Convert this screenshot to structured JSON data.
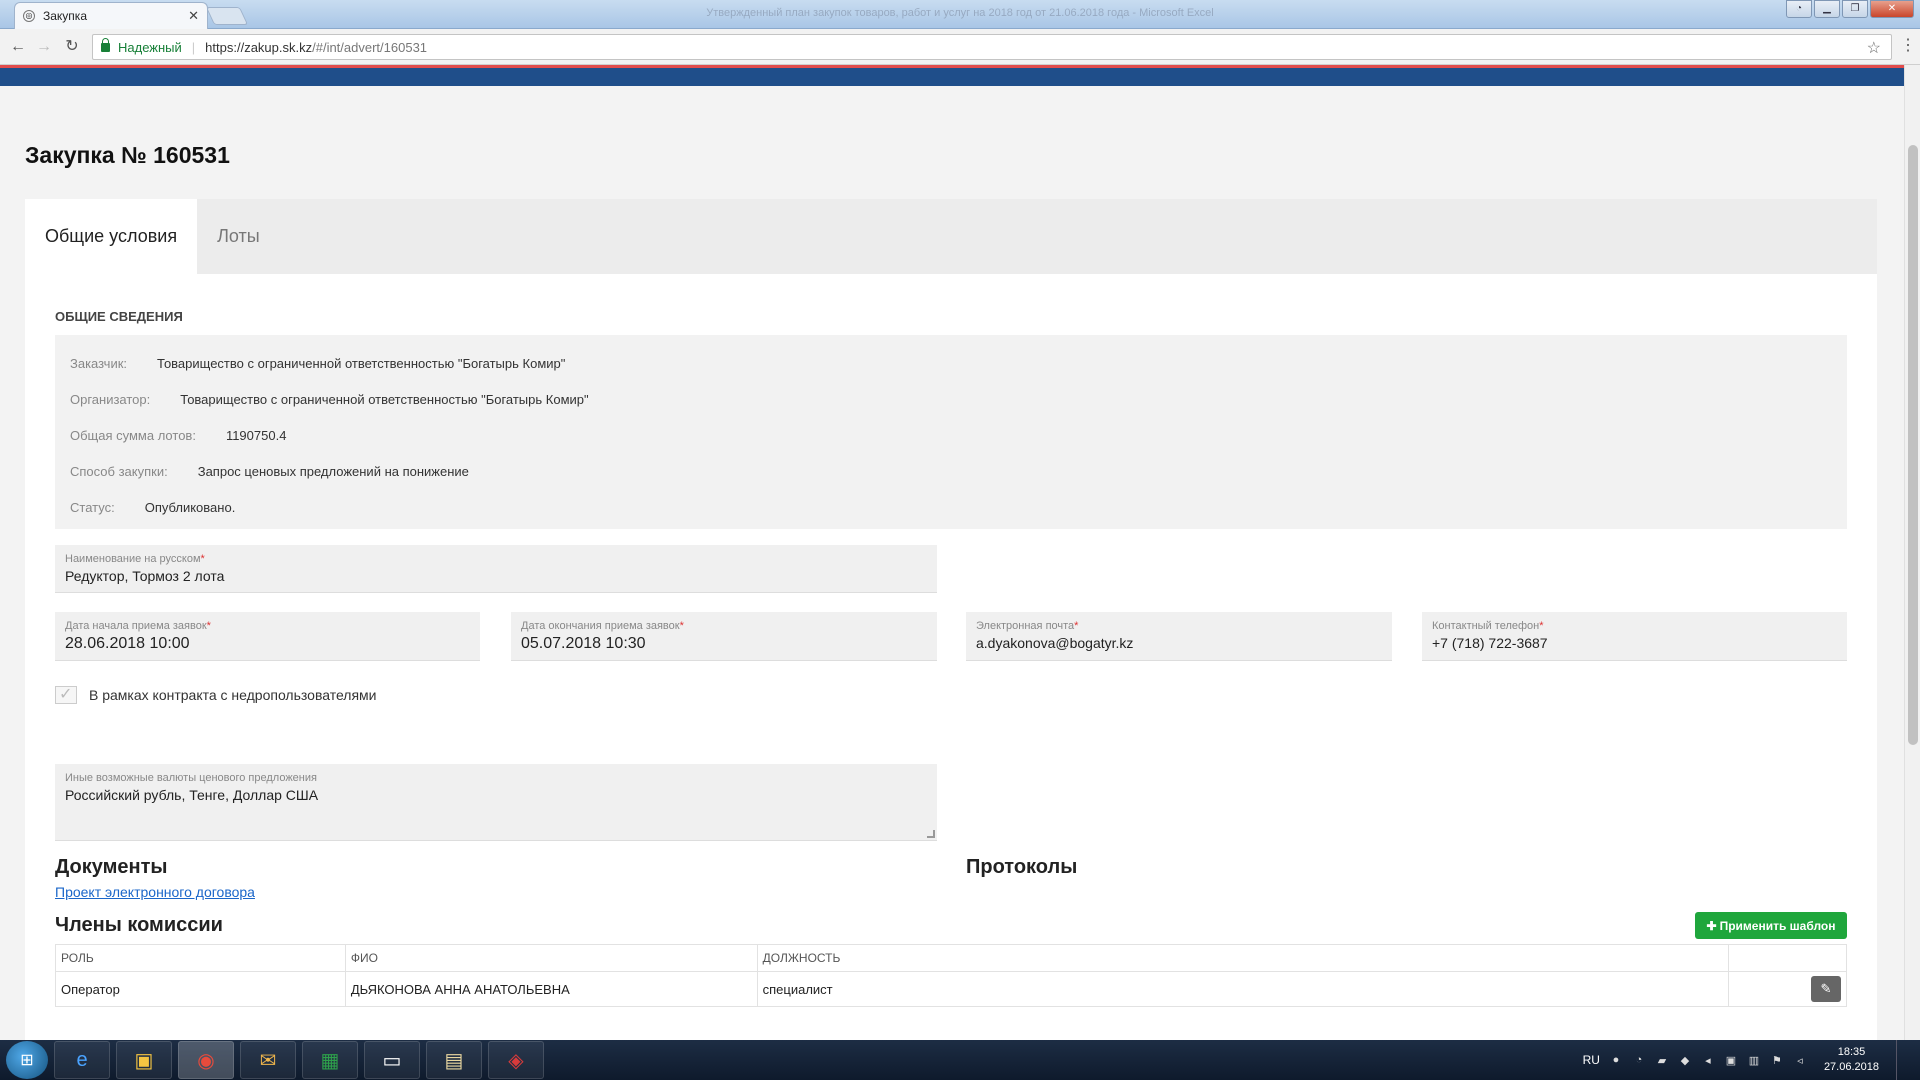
{
  "browser": {
    "tab_title": "Закупка",
    "window_title": "Утвержденный план закупок товаров, работ и услуг на 2018 год от 21.06.2018 года - Microsoft Excel",
    "secure_label": "Надежный",
    "url_host": "https://zakup.sk.kz",
    "url_path": "/#/int/advert/160531"
  },
  "page": {
    "title": "Закупка № 160531",
    "tabs": [
      {
        "label": "Общие условия",
        "active": true
      },
      {
        "label": "Лоты",
        "active": false
      }
    ]
  },
  "general": {
    "heading": "ОБЩИЕ СВЕДЕНИЯ",
    "rows": [
      {
        "key": "Заказчик:",
        "value": "Товарищество с ограниченной ответственностью \"Богатырь Комир\""
      },
      {
        "key": "Организатор:",
        "value": "Товарищество с ограниченной ответственностью \"Богатырь Комир\""
      },
      {
        "key": "Общая сумма лотов:",
        "value": "1190750.4"
      },
      {
        "key": "Способ закупки:",
        "value": "Запрос ценовых предложений на понижение"
      },
      {
        "key": "Статус:",
        "value": "Опубликовано."
      }
    ]
  },
  "fields": {
    "name_ru": {
      "label": "Наименование на русском",
      "value": "Редуктор, Тормоз 2 лота"
    },
    "start_date": {
      "label": "Дата начала приема заявок",
      "value": "28.06.2018 10:00"
    },
    "end_date": {
      "label": "Дата окончания приема заявок",
      "value": "05.07.2018 10:30"
    },
    "email": {
      "label": "Электронная почта",
      "value": "a.dyakonova@bogatyr.kz"
    },
    "phone": {
      "label": "Контактный телефон",
      "value": "+7 (718) 722-3687"
    },
    "currencies": {
      "label": "Иные возможные валюты ценового предложения",
      "value": "Российский  рубль, Тенге, Доллар США"
    },
    "required_mark": "*"
  },
  "checkbox": {
    "label": "В рамках контракта с недропользователями"
  },
  "documents": {
    "heading": "Документы",
    "link": "Проект электронного договора"
  },
  "protocols": {
    "heading": "Протоколы"
  },
  "commission": {
    "heading": "Члены комиссии",
    "apply_template": "Применить шаблон",
    "columns": [
      "РОЛЬ",
      "ФИО",
      "ДОЛЖНОСТЬ"
    ],
    "rows": [
      {
        "role": "Оператор",
        "name": "ДЬЯКОНОВА АННА АНАТОЛЬЕВНА",
        "position": "специалист"
      }
    ]
  },
  "taskbar": {
    "lang": "RU",
    "time": "18:35",
    "date": "27.06.2018"
  }
}
